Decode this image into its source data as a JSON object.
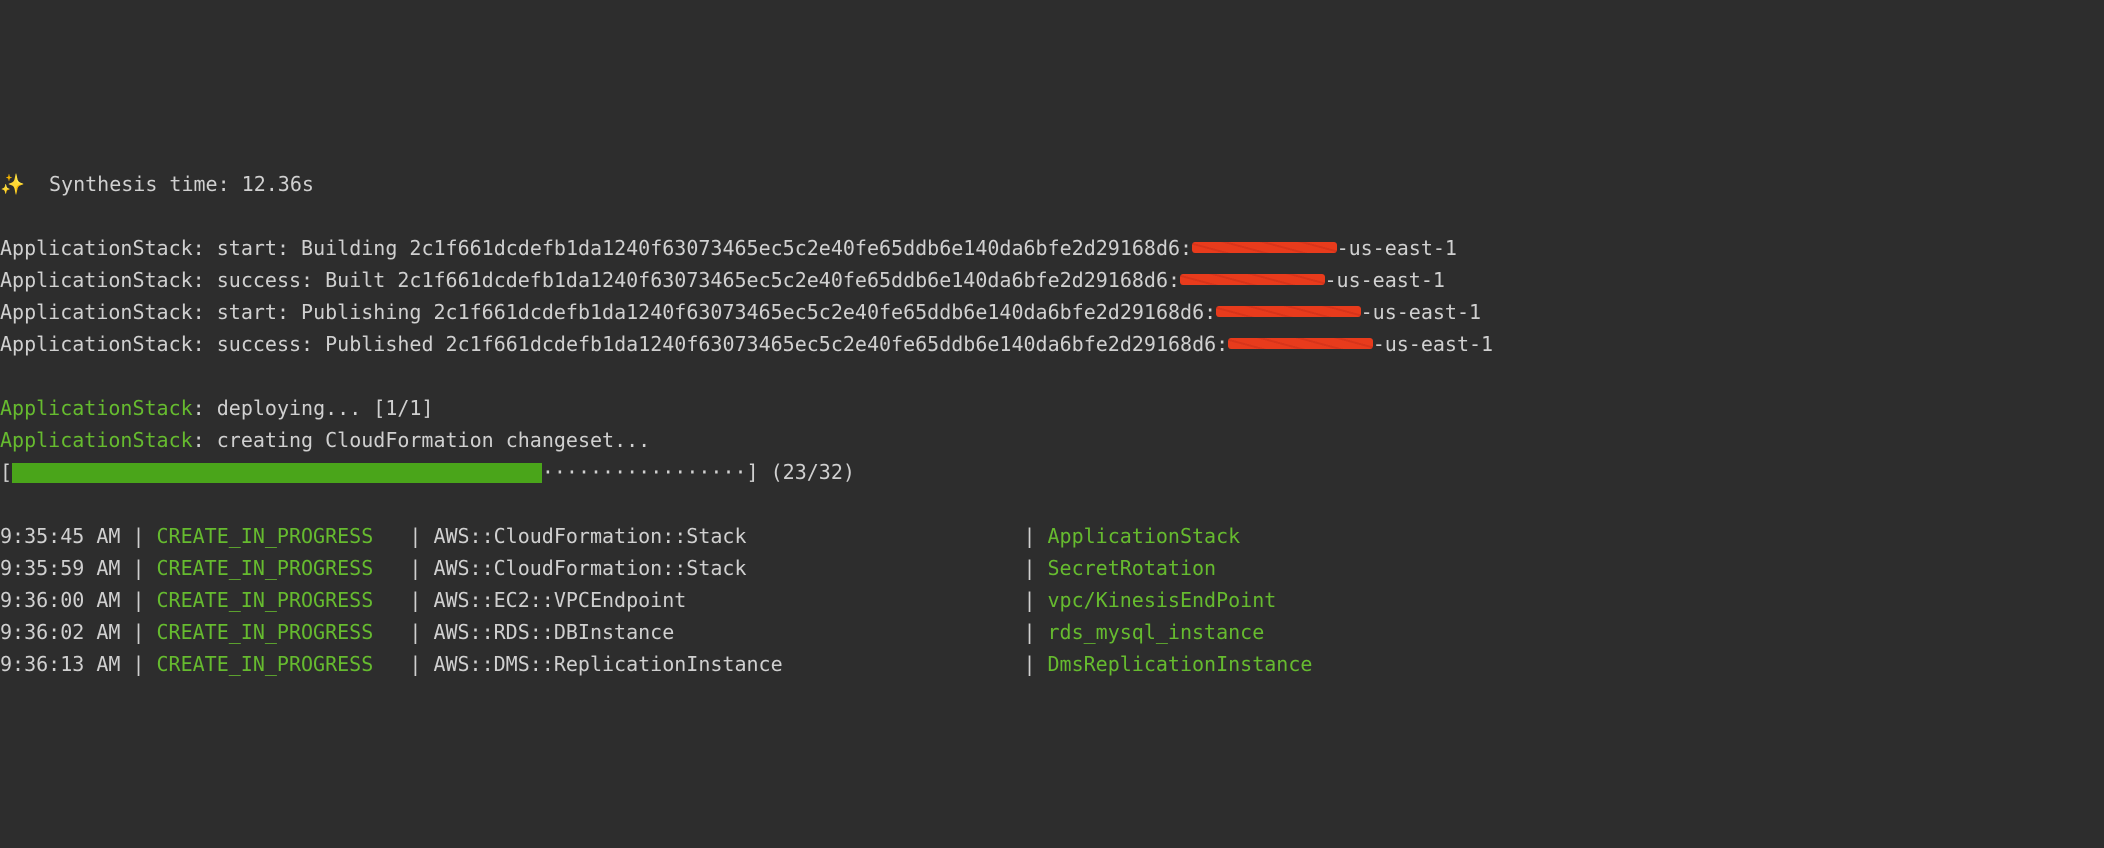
{
  "synthesis": {
    "icon": "✨",
    "label": "Synthesis time:",
    "value": "12.36s"
  },
  "buildLines": [
    {
      "stack": "ApplicationStack:",
      "phase": " start: Building ",
      "hash": "2c1f661dcdefb1da1240f63073465ec5c2e40fe65ddb6e140da6bfe2d29168d6:",
      "redact_chars": 12,
      "suffix": "-us-east-1"
    },
    {
      "stack": "ApplicationStack:",
      "phase": " success: Built ",
      "hash": "2c1f661dcdefb1da1240f63073465ec5c2e40fe65ddb6e140da6bfe2d29168d6:",
      "redact_chars": 12,
      "suffix": "-us-east-1"
    },
    {
      "stack": "ApplicationStack:",
      "phase": " start: Publishing ",
      "hash": "2c1f661dcdefb1da1240f63073465ec5c2e40fe65ddb6e140da6bfe2d29168d6:",
      "redact_chars": 12,
      "suffix": "-us-east-1"
    },
    {
      "stack": "ApplicationStack:",
      "phase": " success: Published ",
      "hash": "2c1f661dcdefb1da1240f63073465ec5c2e40fe65ddb6e140da6bfe2d29168d6:",
      "redact_chars": 12,
      "suffix": "-us-east-1"
    }
  ],
  "deployLine": {
    "stack": "ApplicationStack",
    "text": ": deploying... [1/1]"
  },
  "changesetLine": {
    "stack": "ApplicationStack",
    "text": ": creating CloudFormation changeset..."
  },
  "progress": {
    "open": "[",
    "close": "]",
    "filled": 44,
    "remaining_str": "·················",
    "count": " (23/32)"
  },
  "events": [
    {
      "time": "9:35:45 AM",
      "status": "CREATE_IN_PROGRESS",
      "type": "AWS::CloudFormation::Stack",
      "name": "ApplicationStack"
    },
    {
      "time": "9:35:59 AM",
      "status": "CREATE_IN_PROGRESS",
      "type": "AWS::CloudFormation::Stack",
      "name": "SecretRotation"
    },
    {
      "time": "9:36:00 AM",
      "status": "CREATE_IN_PROGRESS",
      "type": "AWS::EC2::VPCEndpoint",
      "name": "vpc/KinesisEndPoint"
    },
    {
      "time": "9:36:02 AM",
      "status": "CREATE_IN_PROGRESS",
      "type": "AWS::RDS::DBInstance",
      "name": "rds_mysql_instance"
    },
    {
      "time": "9:36:13 AM",
      "status": "CREATE_IN_PROGRESS",
      "type": "AWS::DMS::ReplicationInstance",
      "name": "DmsReplicationInstance"
    }
  ],
  "sep": "|"
}
